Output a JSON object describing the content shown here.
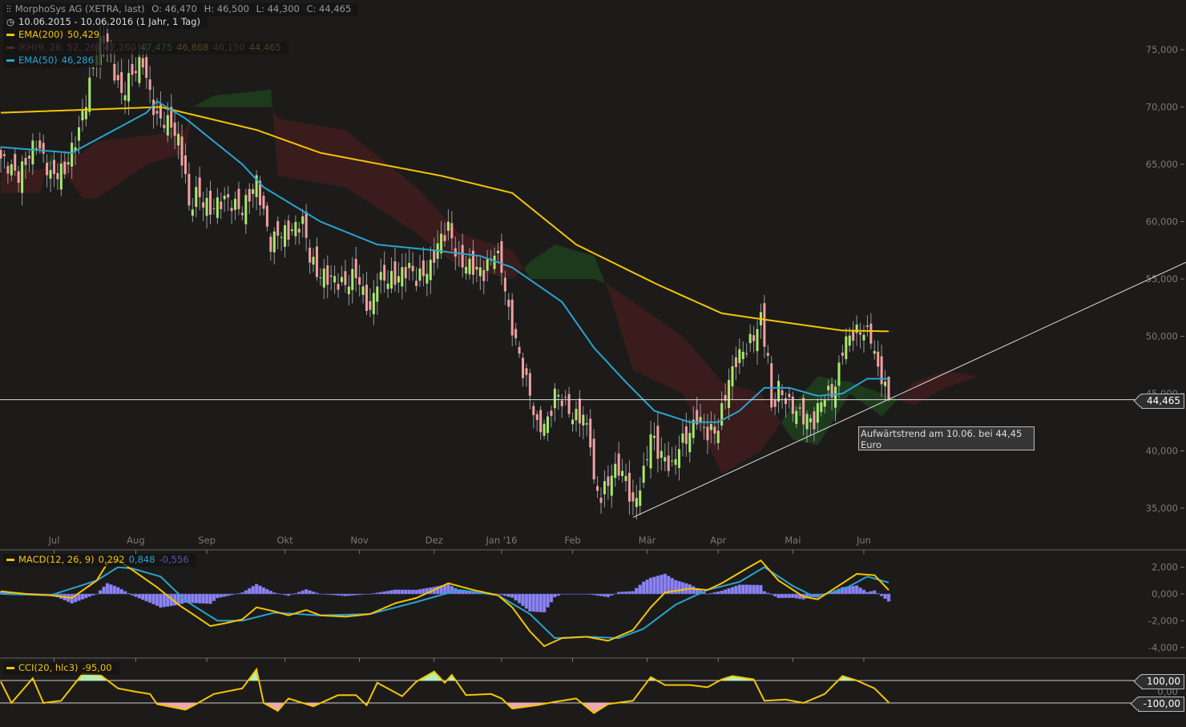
{
  "header": {
    "title": "MorphoSys AG (XETRA, last)",
    "ohlc": {
      "open": "O: 46,470",
      "high": "H: 46,500",
      "low": "L: 44,300",
      "close": "C: 44,465"
    },
    "range": "10.06.2015 - 10.06.2016 (1 Jahr, 1 Tag)",
    "legends": [
      {
        "label": "EMA(200)",
        "value": "50,429",
        "color": "#f5c400"
      },
      {
        "label": "IKH(9, 26, 52, 26)",
        "values": [
          "47,260",
          "47,475",
          "46,868",
          "46,150",
          "44,465"
        ],
        "color": "#4a2a30"
      },
      {
        "label": "EMA(50)",
        "value": "46,286",
        "color": "#2aa3d0"
      }
    ]
  },
  "annotation": "Aufwärtstrend am 10.06. bei 44,45 Euro",
  "last_price_tag": "44,465",
  "colors": {
    "bull": "#a8e86c",
    "bear": "#f2a0a0",
    "ema200": "#f5c400",
    "ema50": "#2aa3d0",
    "macd": "#f5c400",
    "signal": "#2aa3d0",
    "hist": "#8c84f0",
    "cloud_up": "#1e3a1c",
    "cloud_down": "#3a1c1c",
    "cci": "#f5c400",
    "cci_up": "#b4f0b0",
    "cci_down": "#f0a8b0"
  },
  "chart_data": [
    {
      "type": "candlestick",
      "title": "MorphoSys AG (XETRA, last)",
      "x_unit": "trading day index (0 = 10.06.2015, 250 = 10.06.2016)",
      "month_ticks": [
        {
          "label": "Jul",
          "d": 15
        },
        {
          "label": "Aug",
          "d": 38
        },
        {
          "label": "Sep",
          "d": 58
        },
        {
          "label": "Okt",
          "d": 80
        },
        {
          "label": "Nov",
          "d": 101
        },
        {
          "label": "Dez",
          "d": 122
        },
        {
          "label": "Jan '16",
          "d": 141
        },
        {
          "label": "Feb",
          "d": 161
        },
        {
          "label": "Mär",
          "d": 182
        },
        {
          "label": "Apr",
          "d": 202
        },
        {
          "label": "Mai",
          "d": 223
        },
        {
          "label": "Jun",
          "d": 243
        }
      ],
      "y_ticks": [
        "35,000",
        "40,000",
        "45,000",
        "50,000",
        "55,000",
        "60,000",
        "65,000",
        "70,000",
        "75,000"
      ],
      "ylim": [
        32.5,
        78
      ],
      "close_path": [
        [
          0,
          65.5
        ],
        [
          5,
          64
        ],
        [
          10,
          67
        ],
        [
          14,
          64
        ],
        [
          18,
          64.5
        ],
        [
          22,
          68
        ],
        [
          25,
          72
        ],
        [
          27,
          75
        ],
        [
          29,
          76
        ],
        [
          32,
          73
        ],
        [
          34,
          71
        ],
        [
          37,
          73
        ],
        [
          40,
          74
        ],
        [
          42,
          71
        ],
        [
          44,
          69
        ],
        [
          48,
          68.5
        ],
        [
          50,
          67
        ],
        [
          52,
          64
        ],
        [
          53,
          61
        ],
        [
          55,
          62.5
        ],
        [
          59,
          61
        ],
        [
          63,
          62
        ],
        [
          68,
          61
        ],
        [
          72,
          63.5
        ],
        [
          76,
          58
        ],
        [
          78,
          59
        ],
        [
          81,
          59
        ],
        [
          85,
          60
        ],
        [
          87,
          57
        ],
        [
          89,
          55.5
        ],
        [
          93,
          55
        ],
        [
          97,
          54.5
        ],
        [
          100,
          55.5
        ],
        [
          104,
          52
        ],
        [
          106,
          55
        ],
        [
          111,
          55
        ],
        [
          115,
          56
        ],
        [
          117,
          55
        ],
        [
          121,
          56
        ],
        [
          123,
          58
        ],
        [
          126,
          59.5
        ],
        [
          129,
          56.5
        ],
        [
          133,
          56
        ],
        [
          136,
          55.5
        ],
        [
          139,
          57.5
        ],
        [
          141,
          56
        ],
        [
          143,
          52
        ],
        [
          145,
          49.5
        ],
        [
          147,
          47
        ],
        [
          149,
          45
        ],
        [
          151,
          42
        ],
        [
          154,
          42.5
        ],
        [
          156,
          45
        ],
        [
          158,
          44.5
        ],
        [
          161,
          43
        ],
        [
          164,
          43
        ],
        [
          166,
          41
        ],
        [
          167,
          37
        ],
        [
          169,
          36
        ],
        [
          172,
          38
        ],
        [
          174,
          38.5
        ],
        [
          176,
          37.5
        ],
        [
          178,
          35
        ],
        [
          181,
          38
        ],
        [
          183,
          41.5
        ],
        [
          185,
          40
        ],
        [
          189,
          38.5
        ],
        [
          191,
          40.5
        ],
        [
          194,
          41.5
        ],
        [
          196,
          43
        ],
        [
          199,
          41.5
        ],
        [
          202,
          42
        ],
        [
          204,
          45
        ],
        [
          207,
          48
        ],
        [
          210,
          49
        ],
        [
          212,
          50
        ],
        [
          214,
          51.5
        ],
        [
          216,
          48
        ],
        [
          217,
          43.5
        ],
        [
          219,
          45.5
        ],
        [
          222,
          44
        ],
        [
          226,
          43
        ],
        [
          229,
          42.5
        ],
        [
          231,
          44.5
        ],
        [
          235,
          45.5
        ],
        [
          237,
          49
        ],
        [
          239,
          50
        ],
        [
          242,
          50.5
        ],
        [
          245,
          50
        ],
        [
          247,
          47
        ],
        [
          248,
          46.5
        ],
        [
          250,
          44.465
        ]
      ],
      "ema200_path": [
        [
          0,
          69.5
        ],
        [
          45,
          70
        ],
        [
          72,
          68
        ],
        [
          90,
          66
        ],
        [
          124,
          64
        ],
        [
          144,
          62.5
        ],
        [
          162,
          58
        ],
        [
          185,
          54.5
        ],
        [
          203,
          52
        ],
        [
          214,
          51.5
        ],
        [
          237,
          50.5
        ],
        [
          250,
          50.429
        ]
      ],
      "ema50_path": [
        [
          0,
          66.5
        ],
        [
          20,
          66
        ],
        [
          41,
          69.5
        ],
        [
          44,
          70.5
        ],
        [
          52,
          69
        ],
        [
          68,
          65
        ],
        [
          74,
          63
        ],
        [
          90,
          60
        ],
        [
          106,
          58
        ],
        [
          122,
          57.5
        ],
        [
          135,
          57
        ],
        [
          144,
          56
        ],
        [
          158,
          53
        ],
        [
          167,
          49
        ],
        [
          176,
          46
        ],
        [
          184,
          43.5
        ],
        [
          194,
          42.5
        ],
        [
          202,
          42.5
        ],
        [
          208,
          43.5
        ],
        [
          215,
          45.5
        ],
        [
          222,
          45.5
        ],
        [
          230,
          44.8
        ],
        [
          237,
          45
        ],
        [
          244,
          46.3
        ],
        [
          250,
          46.286
        ]
      ],
      "ikh_cloud": [
        [
          0,
          62.5,
          64.5
        ],
        [
          11,
          62.5,
          64.5
        ],
        [
          14,
          66,
          65
        ],
        [
          23,
          62,
          66
        ],
        [
          27,
          62,
          67
        ],
        [
          41,
          65,
          67.5
        ],
        [
          52,
          66,
          68
        ],
        [
          54,
          70,
          70
        ],
        [
          60,
          71,
          70
        ],
        [
          76,
          71.5,
          70
        ],
        [
          78,
          64,
          69
        ],
        [
          97,
          63,
          68
        ],
        [
          117,
          59,
          63
        ],
        [
          129,
          56,
          59
        ],
        [
          144,
          55,
          57.5
        ],
        [
          149,
          56.5,
          55
        ],
        [
          156,
          58,
          55
        ],
        [
          167,
          57,
          55
        ],
        [
          171,
          54,
          54.5
        ],
        [
          178,
          47,
          53
        ],
        [
          192,
          45,
          50
        ],
        [
          203,
          38,
          46
        ],
        [
          214,
          40,
          45
        ],
        [
          223,
          44,
          41
        ],
        [
          230,
          46.5,
          40.5
        ],
        [
          239,
          46,
          45
        ],
        [
          248,
          45,
          43
        ],
        [
          257,
          44,
          46
        ],
        [
          266,
          45.5,
          47
        ],
        [
          275,
          46.5,
          46.5
        ]
      ],
      "trendline": {
        "from": [
          178,
          34.2
        ],
        "to": [
          334,
          56.5
        ]
      },
      "last_price": 44.465
    },
    {
      "type": "line+bar",
      "title": "MACD(12, 26, 9)",
      "legend_values": [
        "0,292",
        "0,848",
        "-0,556"
      ],
      "y_ticks": [
        "2,000",
        "0,000",
        "-2,000",
        "-4,000"
      ],
      "ylim": [
        -5.3,
        3.2
      ],
      "macd_path": [
        [
          0,
          0.2
        ],
        [
          7,
          0
        ],
        [
          14,
          -0.1
        ],
        [
          20,
          -0.3
        ],
        [
          27,
          1
        ],
        [
          30,
          2.3
        ],
        [
          33,
          2.5
        ],
        [
          37,
          1.8
        ],
        [
          44,
          0.5
        ],
        [
          50,
          -0.8
        ],
        [
          54,
          -1.5
        ],
        [
          59,
          -2.4
        ],
        [
          63,
          -2.2
        ],
        [
          68,
          -1.9
        ],
        [
          72,
          -1
        ],
        [
          77,
          -1.3
        ],
        [
          81,
          -1.6
        ],
        [
          86,
          -1.2
        ],
        [
          90,
          -1.6
        ],
        [
          97,
          -1.7
        ],
        [
          104,
          -1.5
        ],
        [
          111,
          -0.7
        ],
        [
          117,
          -0.3
        ],
        [
          122,
          0.3
        ],
        [
          126,
          0.8
        ],
        [
          133,
          0.3
        ],
        [
          140,
          -0.1
        ],
        [
          144,
          -1
        ],
        [
          149,
          -2.8
        ],
        [
          153,
          -3.9
        ],
        [
          158,
          -3.3
        ],
        [
          165,
          -3.2
        ],
        [
          171,
          -3.5
        ],
        [
          178,
          -2.7
        ],
        [
          183,
          -1
        ],
        [
          187,
          0.1
        ],
        [
          194,
          0.4
        ],
        [
          199,
          0.3
        ],
        [
          203,
          0.8
        ],
        [
          210,
          1.9
        ],
        [
          214,
          2.5
        ],
        [
          219,
          1
        ],
        [
          226,
          -0.2
        ],
        [
          230,
          -0.4
        ],
        [
          237,
          0.8
        ],
        [
          241,
          1.5
        ],
        [
          246,
          1.4
        ],
        [
          250,
          0.292
        ]
      ],
      "signal_path": [
        [
          0,
          0
        ],
        [
          14,
          -0.1
        ],
        [
          27,
          1
        ],
        [
          33,
          2
        ],
        [
          37,
          1.9
        ],
        [
          45,
          1.3
        ],
        [
          52,
          -0.5
        ],
        [
          61,
          -2
        ],
        [
          68,
          -2
        ],
        [
          77,
          -1.4
        ],
        [
          90,
          -1.6
        ],
        [
          104,
          -1.5
        ],
        [
          117,
          -0.6
        ],
        [
          129,
          0.3
        ],
        [
          140,
          -0.1
        ],
        [
          149,
          -1.5
        ],
        [
          156,
          -3.3
        ],
        [
          165,
          -3.2
        ],
        [
          174,
          -3.3
        ],
        [
          181,
          -2.6
        ],
        [
          190,
          -0.8
        ],
        [
          199,
          0.3
        ],
        [
          208,
          0.9
        ],
        [
          215,
          2
        ],
        [
          223,
          0.6
        ],
        [
          229,
          -0.2
        ],
        [
          237,
          0.3
        ],
        [
          244,
          1.3
        ],
        [
          250,
          0.848
        ]
      ]
    },
    {
      "type": "line",
      "title": "CCI(20, hlc3)",
      "legend_value": "-95,00",
      "y_ticks": [
        "100,00",
        "0,00",
        "-100,00"
      ],
      "ylim": [
        -250,
        250
      ],
      "cci_path": [
        [
          0,
          90
        ],
        [
          3,
          -100
        ],
        [
          9,
          120
        ],
        [
          12,
          -100
        ],
        [
          17,
          -80
        ],
        [
          23,
          160
        ],
        [
          28,
          150
        ],
        [
          33,
          30
        ],
        [
          38,
          0
        ],
        [
          42,
          -20
        ],
        [
          44,
          -110
        ],
        [
          52,
          -160
        ],
        [
          55,
          -110
        ],
        [
          60,
          -20
        ],
        [
          68,
          30
        ],
        [
          72,
          200
        ],
        [
          74,
          -100
        ],
        [
          78,
          -170
        ],
        [
          81,
          -60
        ],
        [
          88,
          -130
        ],
        [
          95,
          -30
        ],
        [
          100,
          -30
        ],
        [
          103,
          -120
        ],
        [
          106,
          80
        ],
        [
          113,
          -40
        ],
        [
          117,
          90
        ],
        [
          122,
          180
        ],
        [
          125,
          80
        ],
        [
          127,
          150
        ],
        [
          131,
          -30
        ],
        [
          138,
          -20
        ],
        [
          141,
          -60
        ],
        [
          144,
          -150
        ],
        [
          151,
          -120
        ],
        [
          156,
          -90
        ],
        [
          162,
          -60
        ],
        [
          167,
          -190
        ],
        [
          171,
          -110
        ],
        [
          178,
          -80
        ],
        [
          183,
          130
        ],
        [
          187,
          60
        ],
        [
          194,
          60
        ],
        [
          199,
          40
        ],
        [
          203,
          110
        ],
        [
          206,
          140
        ],
        [
          212,
          110
        ],
        [
          215,
          -80
        ],
        [
          221,
          -70
        ],
        [
          226,
          -100
        ],
        [
          232,
          -20
        ],
        [
          237,
          140
        ],
        [
          241,
          100
        ],
        [
          246,
          30
        ],
        [
          250,
          -95
        ]
      ]
    }
  ]
}
